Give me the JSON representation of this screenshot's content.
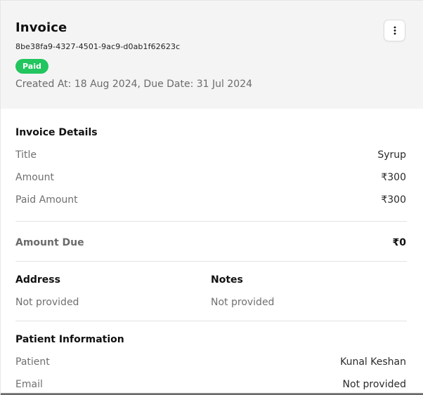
{
  "invoice": {
    "title": "Invoice",
    "id": "8be38fa9-4327-4501-9ac9-d0ab1f62623c",
    "status": "Paid",
    "status_color": "#22c55e",
    "dates_line": "Created At: 18 Aug 2024, Due Date: 31 Jul 2024",
    "menu_icon": "more-vertical-icon"
  },
  "details": {
    "heading": "Invoice Details",
    "rows": [
      {
        "label": "Title",
        "value": "Syrup"
      },
      {
        "label": "Amount",
        "value": "₹300"
      },
      {
        "label": "Paid Amount",
        "value": "₹300"
      }
    ]
  },
  "due": {
    "label": "Amount Due",
    "value": "₹0"
  },
  "address": {
    "heading": "Address",
    "value": "Not provided"
  },
  "notes": {
    "heading": "Notes",
    "value": "Not provided"
  },
  "patient": {
    "heading": "Patient Information",
    "rows": [
      {
        "label": "Patient",
        "value": "Kunal Keshan"
      },
      {
        "label": "Email",
        "value": "Not provided"
      }
    ]
  }
}
